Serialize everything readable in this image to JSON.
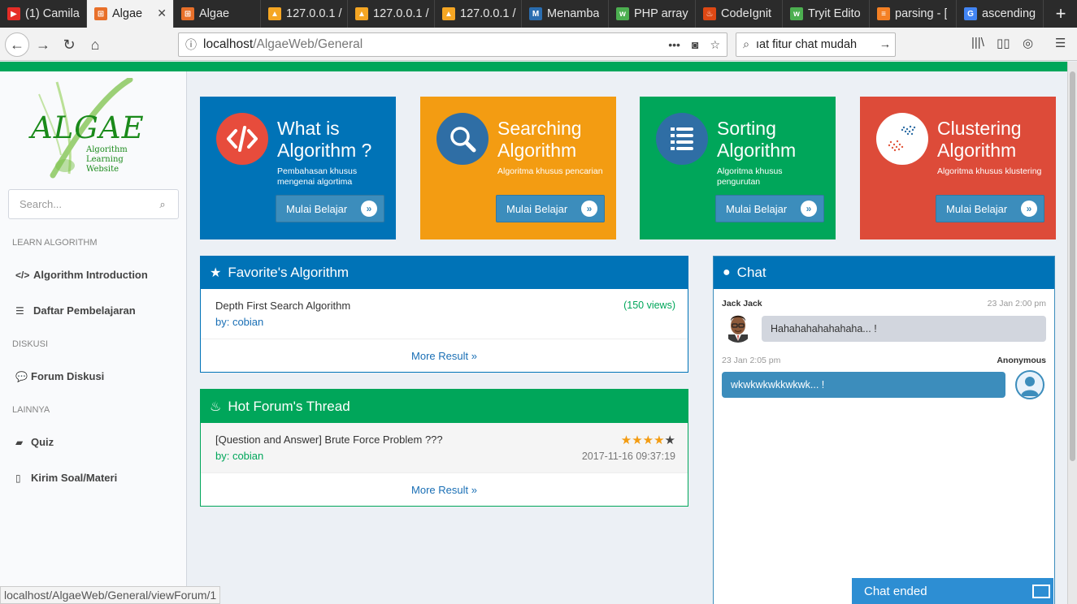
{
  "browser": {
    "tabs": [
      {
        "label": "(1) Camila",
        "favicon": "youtube-icon",
        "color": "#e52d27",
        "glyph": "▶"
      },
      {
        "label": "Algae",
        "favicon": "algae-icon",
        "color": "#e8702a",
        "glyph": "⊞",
        "active": true
      },
      {
        "label": "Algae",
        "favicon": "algae-icon",
        "color": "#e8702a",
        "glyph": "⊞"
      },
      {
        "label": "127.0.0.1 /",
        "favicon": "phpmyadmin-icon",
        "color": "#f5a623",
        "glyph": "▲"
      },
      {
        "label": "127.0.0.1 /",
        "favicon": "phpmyadmin-icon",
        "color": "#f5a623",
        "glyph": "▲"
      },
      {
        "label": "127.0.0.1 /",
        "favicon": "phpmyadmin-icon",
        "color": "#f5a623",
        "glyph": "▲"
      },
      {
        "label": "Menamba",
        "favicon": "m-icon",
        "color": "#2a6db0",
        "glyph": "M"
      },
      {
        "label": "PHP array",
        "favicon": "w3-icon",
        "color": "#4caf50",
        "glyph": "w"
      },
      {
        "label": "CodeIgnit",
        "favicon": "codeigniter-icon",
        "color": "#dd4814",
        "glyph": "♨"
      },
      {
        "label": "Tryit Edito",
        "favicon": "w3-icon",
        "color": "#4caf50",
        "glyph": "w"
      },
      {
        "label": "parsing - [",
        "favicon": "stackoverflow-icon",
        "color": "#f48024",
        "glyph": "≡"
      },
      {
        "label": "ascending",
        "favicon": "google-icon",
        "color": "#4285f4",
        "glyph": "G"
      }
    ],
    "url_host": "localhost",
    "url_path": "/AlgaeWeb/General",
    "search_text": "ıat fitur chat mudah",
    "status_url": "localhost/AlgaeWeb/General/viewForum/1"
  },
  "sidebar": {
    "logo_text": "ALGAE",
    "logo_sub": [
      "Algorithm",
      "Learning",
      "Website"
    ],
    "search_placeholder": "Search...",
    "sections": [
      {
        "header": "LEARN ALGORITHM",
        "items": [
          {
            "label": "Algorithm Introduction",
            "icon": "code-icon"
          },
          {
            "label": "Daftar Pembelajaran",
            "icon": "list-icon"
          }
        ]
      },
      {
        "header": "DISKUSI",
        "items": [
          {
            "label": "Forum Diskusi",
            "icon": "comment-icon"
          }
        ]
      },
      {
        "header": "LAINNYA",
        "items": [
          {
            "label": "Quiz",
            "icon": "book-icon"
          },
          {
            "label": "Kirim Soal/Materi",
            "icon": "file-icon"
          }
        ]
      }
    ]
  },
  "tiles": [
    {
      "title": "What is Algorithm ?",
      "desc": "Pembahasan khusus mengenai algortima",
      "button": "Mulai Belajar",
      "bg": "#0073b7",
      "circle": "#e74c3c",
      "icon": "code-icon"
    },
    {
      "title": "Searching Algorithm",
      "desc": "Algoritma khusus pencarian",
      "button": "Mulai Belajar",
      "bg": "#f39c12",
      "circle": "#2f6ea5",
      "icon": "search-icon"
    },
    {
      "title": "Sorting Algorithm",
      "desc": "Algoritma khusus pengurutan",
      "button": "Mulai Belajar",
      "bg": "#00a65a",
      "circle": "#2f6ea5",
      "icon": "list-icon"
    },
    {
      "title": "Clustering Algorithm",
      "desc": "Algoritma khusus klustering",
      "button": "Mulai Belajar",
      "bg": "#dd4b39",
      "circle": "#ffffff",
      "icon": "scatter-icon"
    }
  ],
  "favorite": {
    "title": "Favorite's Algorithm",
    "color": "#0073b7",
    "items": [
      {
        "title": "Depth First Search Algorithm",
        "by": "by: cobian",
        "views": "(150 views)"
      }
    ],
    "more": "More Result »"
  },
  "hot": {
    "title": "Hot Forum's Thread",
    "color": "#00a65a",
    "items": [
      {
        "title": "[Question and Answer] Brute Force Problem ???",
        "by": "by: cobian",
        "rating": 4,
        "max": 5,
        "date": "2017-11-16 09:37:19"
      }
    ],
    "more": "More Result »"
  },
  "chat": {
    "title": "Chat",
    "color": "#0073b7",
    "messages": [
      {
        "name": "Jack Jack",
        "time": "23 Jan 2:00 pm",
        "text": "Hahahahahahahaha... !"
      },
      {
        "name": "Anonymous",
        "time": "23 Jan 2:05 pm",
        "text": "wkwkwkwkkwkwk... !"
      }
    ],
    "ended_label": "Chat ended"
  }
}
